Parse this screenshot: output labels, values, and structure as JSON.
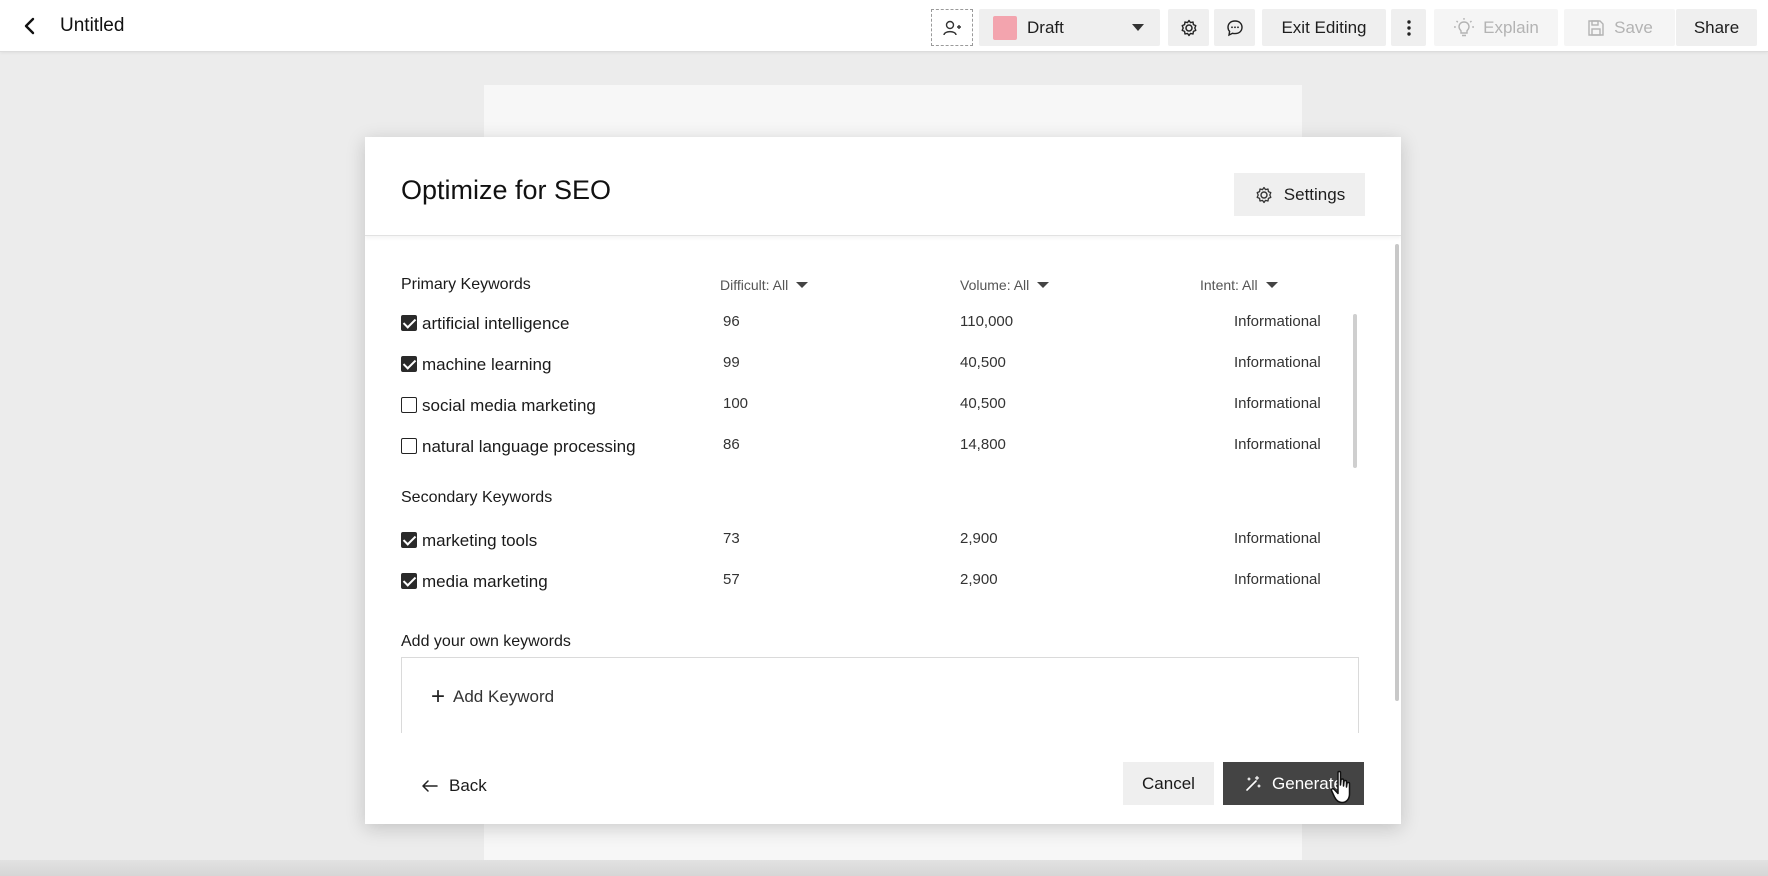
{
  "topbar": {
    "title": "Untitled",
    "status": {
      "label": "Draft",
      "swatch_color": "#f3a4ae"
    },
    "exit_editing_label": "Exit Editing",
    "explain_label": "Explain",
    "save_label": "Save",
    "share_label": "Share"
  },
  "modal": {
    "title": "Optimize for SEO",
    "settings_label": "Settings",
    "primary_title": "Primary Keywords",
    "columns": {
      "difficult": "Difficult: All",
      "volume": "Volume: All",
      "intent": "Intent: All"
    },
    "primary": [
      {
        "keyword": "artificial intelligence",
        "difficulty": "96",
        "volume": "110,000",
        "intent": "Informational",
        "checked": true
      },
      {
        "keyword": "machine learning",
        "difficulty": "99",
        "volume": "40,500",
        "intent": "Informational",
        "checked": true
      },
      {
        "keyword": "social media marketing",
        "difficulty": "100",
        "volume": "40,500",
        "intent": "Informational",
        "checked": false
      },
      {
        "keyword": "natural language processing",
        "difficulty": "86",
        "volume": "14,800",
        "intent": "Informational",
        "checked": false
      }
    ],
    "secondary_title": "Secondary Keywords",
    "secondary": [
      {
        "keyword": "marketing tools",
        "difficulty": "73",
        "volume": "2,900",
        "intent": "Informational",
        "checked": true
      },
      {
        "keyword": "media marketing",
        "difficulty": "57",
        "volume": "2,900",
        "intent": "Informational",
        "checked": true
      }
    ],
    "own_title": "Add your own keywords",
    "add_keyword_label": "Add Keyword",
    "back_label": "Back",
    "cancel_label": "Cancel",
    "generate_label": "Generate"
  }
}
